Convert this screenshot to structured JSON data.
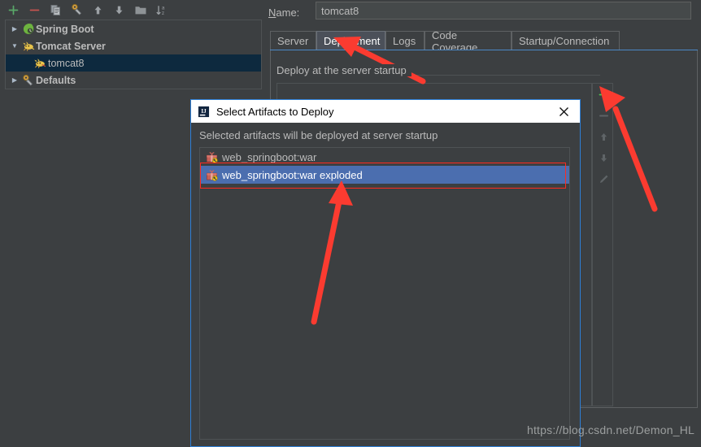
{
  "left_panel": {
    "toolbar": [
      {
        "name": "add-icon",
        "glyph": "+",
        "title": "Add New Configuration"
      },
      {
        "name": "remove-icon",
        "glyph": "−",
        "title": "Remove Configuration"
      },
      {
        "name": "copy-icon",
        "glyph": "copy",
        "title": "Copy Configuration"
      },
      {
        "name": "edit-templates-icon",
        "glyph": "wrench",
        "title": "Edit Templates"
      },
      {
        "name": "move-up-icon",
        "glyph": "↑",
        "title": "Move Up"
      },
      {
        "name": "move-down-icon",
        "glyph": "↓",
        "title": "Move Down"
      },
      {
        "name": "folder-icon",
        "glyph": "folder",
        "title": "Create New Folder"
      },
      {
        "name": "sort-icon",
        "glyph": "sort-az",
        "title": "Sort Configurations"
      }
    ],
    "tree": [
      {
        "label": "Spring Boot",
        "arrow": "collapsed",
        "icon": "spring-boot-icon",
        "bold": true,
        "selected": false,
        "indent": 0
      },
      {
        "label": "Tomcat Server",
        "arrow": "expanded",
        "icon": "tomcat-icon",
        "bold": true,
        "selected": false,
        "indent": 0
      },
      {
        "label": "tomcat8",
        "arrow": "none",
        "icon": "tomcat-icon",
        "bold": false,
        "selected": true,
        "indent": 1
      },
      {
        "label": "Defaults",
        "arrow": "collapsed",
        "icon": "wrench-icon",
        "bold": true,
        "selected": false,
        "indent": 0
      }
    ]
  },
  "right_panel": {
    "name_label": "Name:",
    "name_value": "tomcat8",
    "name_placeholder": "",
    "tabs": [
      {
        "label": "Server",
        "active": false
      },
      {
        "label": "Deployment",
        "active": true
      },
      {
        "label": "Logs",
        "active": false
      },
      {
        "label": "Code Coverage",
        "active": false
      },
      {
        "label": "Startup/Connection",
        "active": false
      }
    ],
    "deploy_section_label": "Deploy at the server startup",
    "side_buttons": [
      {
        "name": "add-artifact-button",
        "glyph": "+",
        "enabled": true
      },
      {
        "name": "remove-artifact-button",
        "glyph": "−",
        "enabled": false
      },
      {
        "name": "move-up-button",
        "glyph": "↑",
        "enabled": false
      },
      {
        "name": "move-down-button",
        "glyph": "↓",
        "enabled": false
      },
      {
        "name": "edit-artifact-button",
        "glyph": "pencil",
        "enabled": false
      }
    ]
  },
  "dialog": {
    "title": "Select Artifacts to Deploy",
    "logo": "intellij-idea-icon",
    "close_label": "✕",
    "hint": "Selected artifacts will be deployed at server startup",
    "artifacts": [
      {
        "label": "web_springboot:war",
        "icon": "artifact-icon",
        "selected": false
      },
      {
        "label": "web_springboot:war exploded",
        "icon": "artifact-icon",
        "selected": true
      }
    ]
  },
  "annotations": {
    "highlight_color": "#ff2b20",
    "arrow_to_deployment_tab": "Deployment",
    "arrow_to_selected_artifact": "web_springboot:war exploded",
    "arrow_to_add_button": "+"
  },
  "watermark": "https://blog.csdn.net/Demon_HL",
  "colors": {
    "background": "#3c3f41",
    "selection_blue": "#4b6eaf",
    "tree_selection": "#0d293e",
    "accent_blue": "#2e7fd6",
    "annotation_red": "#ff2b20",
    "add_green": "#4ec94e",
    "text": "#bbbbbb"
  }
}
